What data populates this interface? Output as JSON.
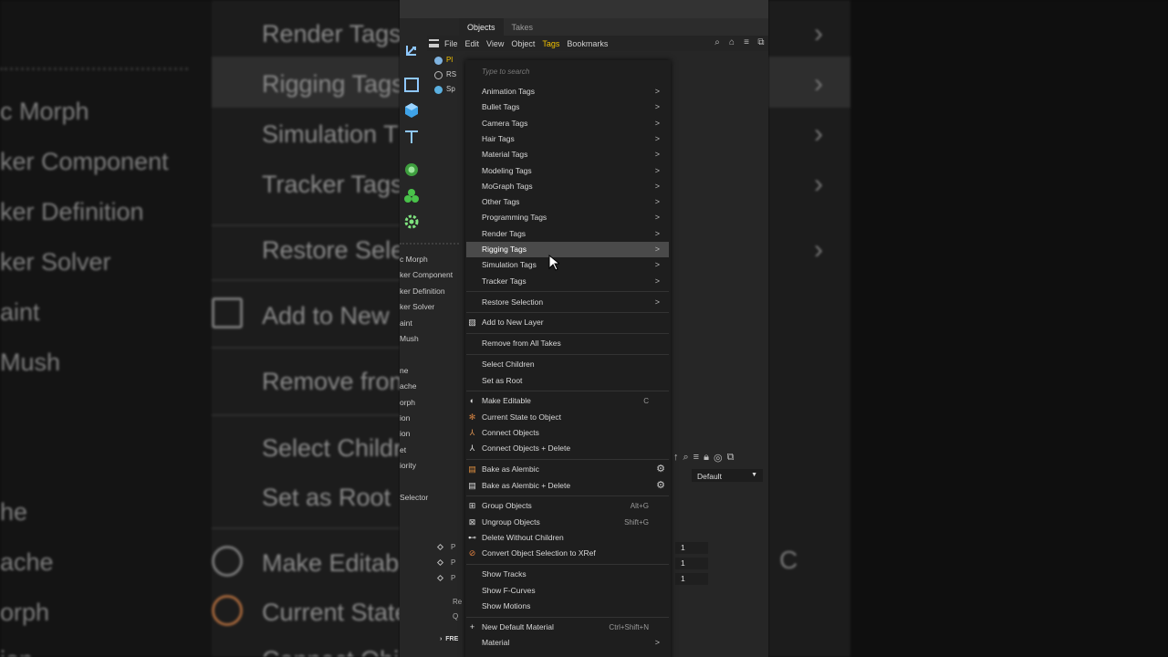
{
  "background_zoom": {
    "left_items": [
      "Render Tags",
      "Rigging Tags",
      "Simulation T",
      "Tracker Tags",
      "Restore Sele",
      "Add to New",
      "Remove from",
      "Select Childr",
      "Set as Root",
      "Make Editab",
      "Current State",
      "Connect Obj"
    ],
    "left_partial": [
      "c Morph",
      "ker Component",
      "ker Definition",
      "ker Solver",
      "aint",
      "Mush",
      "he",
      "ache",
      "orph",
      "ion"
    ],
    "right_letter": "C"
  },
  "window": {
    "tabs": [
      "Objects",
      "Takes"
    ],
    "menubar": [
      "File",
      "Edit",
      "View",
      "Object",
      "Tags",
      "Bookmarks"
    ],
    "objects": [
      {
        "label": "Pl",
        "color": "#7fb3e0",
        "selected": true
      },
      {
        "label": "RS",
        "color": "#bbbbbb",
        "selected": false
      },
      {
        "label": "Sp",
        "color": "#5bb0e0",
        "selected": false
      }
    ],
    "left_list": [
      "c Morph",
      "ker Component",
      "ker Definition",
      "ker Solver",
      "aint",
      "Mush",
      "",
      "ne",
      "ache",
      "orph",
      "ion",
      "ion",
      "et",
      "iority",
      "",
      "Selector"
    ],
    "default_select": "Default",
    "numbers": [
      "1",
      "1",
      "1"
    ],
    "param_rows": [
      "P",
      "P",
      "P"
    ],
    "low_labels": [
      "Re",
      "Q"
    ],
    "fre_label": "FRE"
  },
  "context_menu": {
    "search_placeholder": "Type to search",
    "groups": [
      {
        "items": [
          {
            "label": "Animation Tags",
            "submenu": true
          },
          {
            "label": "Bullet Tags",
            "submenu": true
          },
          {
            "label": "Camera Tags",
            "submenu": true
          },
          {
            "label": "Hair Tags",
            "submenu": true
          },
          {
            "label": "Material Tags",
            "submenu": true
          },
          {
            "label": "Modeling Tags",
            "submenu": true
          },
          {
            "label": "MoGraph Tags",
            "submenu": true
          },
          {
            "label": "Other Tags",
            "submenu": true
          },
          {
            "label": "Programming Tags",
            "submenu": true
          },
          {
            "label": "Render Tags",
            "submenu": true
          },
          {
            "label": "Rigging Tags",
            "submenu": true,
            "hover": true
          },
          {
            "label": "Simulation Tags",
            "submenu": true
          },
          {
            "label": "Tracker Tags",
            "submenu": true
          }
        ]
      },
      {
        "items": [
          {
            "label": "Restore Selection",
            "submenu": true
          }
        ]
      },
      {
        "items": [
          {
            "label": "Add to New Layer",
            "icon": "layer-icon"
          }
        ]
      },
      {
        "items": [
          {
            "label": "Remove from All Takes"
          }
        ]
      },
      {
        "items": [
          {
            "label": "Select Children"
          },
          {
            "label": "Set as Root"
          }
        ]
      },
      {
        "items": [
          {
            "label": "Make Editable",
            "icon": "make-editable-icon",
            "shortcut": "C"
          },
          {
            "label": "Current State to Object",
            "icon": "current-state-icon"
          },
          {
            "label": "Connect Objects",
            "icon": "connect-icon"
          },
          {
            "label": "Connect Objects + Delete",
            "icon": "connect-delete-icon"
          }
        ]
      },
      {
        "items": [
          {
            "label": "Bake as Alembic",
            "icon": "alembic-icon",
            "gear": true
          },
          {
            "label": "Bake as Alembic + Delete",
            "icon": "alembic-delete-icon",
            "gear": true
          }
        ]
      },
      {
        "items": [
          {
            "label": "Group Objects",
            "icon": "group-icon",
            "shortcut": "Alt+G"
          },
          {
            "label": "Ungroup Objects",
            "icon": "ungroup-icon",
            "shortcut": "Shift+G"
          },
          {
            "label": "Delete Without Children",
            "icon": "delete-without-children-icon"
          },
          {
            "label": "Convert Object Selection to XRef",
            "icon": "xref-icon"
          }
        ]
      },
      {
        "items": [
          {
            "label": "Show Tracks"
          },
          {
            "label": "Show F-Curves"
          },
          {
            "label": "Show Motions"
          }
        ]
      },
      {
        "items": [
          {
            "label": "New Default Material",
            "icon": "plus-icon",
            "shortcut": "Ctrl+Shift+N"
          },
          {
            "label": "Material",
            "submenu": true
          }
        ]
      }
    ]
  }
}
